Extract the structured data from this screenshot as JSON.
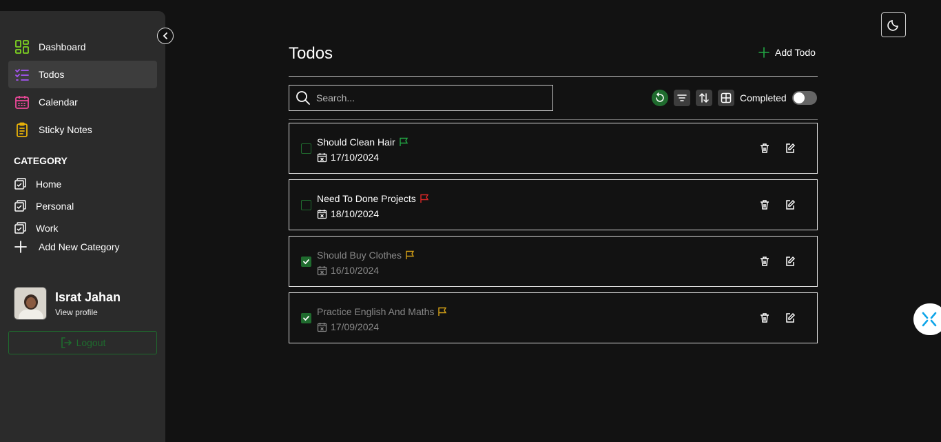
{
  "sidebar": {
    "nav": [
      {
        "label": "Dashboard",
        "icon": "dashboard-icon",
        "color": "#7ed321"
      },
      {
        "label": "Todos",
        "icon": "checklist-icon",
        "color": "#a855f7"
      },
      {
        "label": "Calendar",
        "icon": "calendar-icon",
        "color": "#ec4899"
      },
      {
        "label": "Sticky Notes",
        "icon": "clipboard-icon",
        "color": "#eab308"
      }
    ],
    "category_title": "CATEGORY",
    "categories": [
      "Home",
      "Personal",
      "Work"
    ],
    "add_category": "Add New Category",
    "profile": {
      "name": "Israt Jahan",
      "link": "View profile"
    },
    "logout": "Logout"
  },
  "main": {
    "title": "Todos",
    "add_todo": "Add Todo",
    "search_placeholder": "Search...",
    "completed_label": "Completed",
    "completed_toggle_on": false
  },
  "todos": [
    {
      "title": "Should Clean Hair",
      "date": "17/10/2024",
      "done": false,
      "flag_color": "#22a845"
    },
    {
      "title": "Need To Done Projects",
      "date": "18/10/2024",
      "done": false,
      "flag_color": "#dc2626"
    },
    {
      "title": "Should Buy Clothes",
      "date": "16/10/2024",
      "done": true,
      "flag_color": "#d4a017"
    },
    {
      "title": "Practice English And Maths",
      "date": "17/09/2024",
      "done": true,
      "flag_color": "#d4a017"
    }
  ],
  "colors": {
    "accent": "#1f6b2e",
    "background": "#121212",
    "sidebar": "#2b2b2b"
  }
}
